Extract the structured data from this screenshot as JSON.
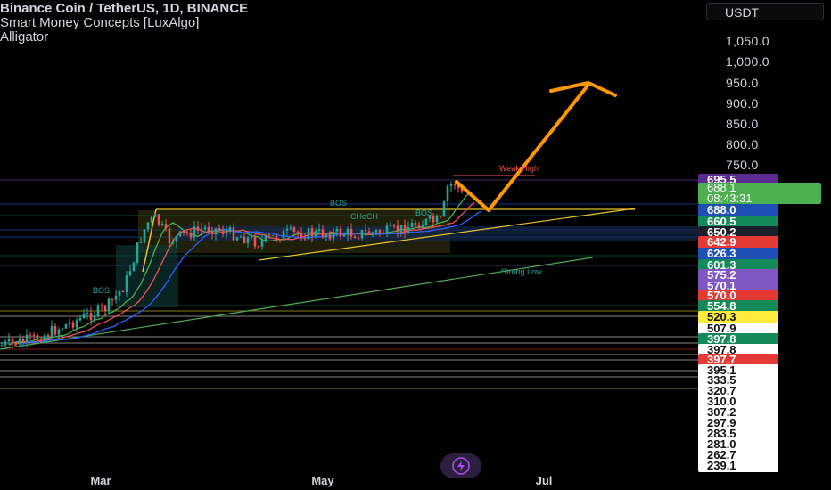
{
  "legend": {
    "symbol_line": "Binance Coin / TetherUS, 1D, BINANCE",
    "indicator_1": "Smart Money Concepts [LuxAlgo]",
    "indicator_2": "Alligator"
  },
  "currency": "USDT",
  "x_axis_labels": [
    "Mar",
    "May",
    "Jul"
  ],
  "y_axis_ticks": [
    "1,050.0",
    "1,000.0",
    "950.0",
    "900.0",
    "850.0",
    "800.0",
    "750.0"
  ],
  "price_labels": [
    {
      "text": "695.5",
      "color": "#5b2a91"
    },
    {
      "text": "688.0",
      "color": "#1e4fb5"
    },
    {
      "text": "660.5",
      "color": "#138a57"
    },
    {
      "text": "650.2",
      "color": "#1b1f2b"
    },
    {
      "text": "642.9",
      "color": "#e53935"
    },
    {
      "text": "626.3",
      "color": "#1e4fb5"
    },
    {
      "text": "601.3",
      "color": "#138a57"
    },
    {
      "text": "575.2",
      "color": "#7e57c2"
    },
    {
      "text": "570.1",
      "color": "#7e57c2"
    },
    {
      "text": "570.0",
      "color": "#e53935"
    },
    {
      "text": "554.8",
      "color": "#138a57"
    },
    {
      "text": "520.3",
      "color": "#ffeb3b"
    },
    {
      "text": "507.9",
      "color": "#ffffff"
    },
    {
      "text": "397.8",
      "color": "#138a57"
    },
    {
      "text": "397.8",
      "color": "#ffffff"
    },
    {
      "text": "397.7",
      "color": "#e53935"
    },
    {
      "text": "395.1",
      "color": "#ffffff"
    },
    {
      "text": "333.5",
      "color": "#ffffff"
    },
    {
      "text": "320.7",
      "color": "#ffffff"
    },
    {
      "text": "310.0",
      "color": "#ffffff"
    },
    {
      "text": "307.2",
      "color": "#ffffff"
    },
    {
      "text": "297.9",
      "color": "#ffffff"
    },
    {
      "text": "283.5",
      "color": "#ffffff"
    },
    {
      "text": "281.0",
      "color": "#ffffff"
    },
    {
      "text": "262.7",
      "color": "#ffffff"
    },
    {
      "text": "239.1",
      "color": "#ffffff"
    }
  ],
  "current_price": {
    "price": "688.1",
    "countdown": "08:43:31",
    "color": "#4caf50"
  },
  "annotations": {
    "weak_high": "Weak High",
    "strong_low": "Strong Low",
    "bos_top": "BOS",
    "bos_left": "BOS",
    "bos_mid": "BOS",
    "choch": "CHoCH"
  },
  "colors": {
    "bull": "#26a69a",
    "bear": "#ef5350",
    "arrow": "#ff9800",
    "trendline": "#e6c229",
    "green_line": "#4caf50",
    "blue_ma": "#2962ff"
  },
  "chart_data": {
    "type": "candlestick",
    "symbol": "Binance Coin / TetherUS",
    "interval": "1D",
    "exchange": "BINANCE",
    "x": [
      "Mar",
      "May",
      "Jul"
    ],
    "ylim": [
      230,
      1115
    ],
    "key_levels": [
      695.5,
      688.0,
      660.5,
      650.2,
      642.9,
      626.3,
      601.3,
      575.2,
      570.1,
      570.0,
      554.8,
      520.3,
      507.9,
      397.8,
      397.7,
      395.1,
      333.5,
      320.7,
      310.0,
      307.2,
      297.9,
      283.5,
      281.0,
      262.7,
      239.1
    ],
    "last_price": 688.1,
    "projection": [
      [
        688.0,
        712.0
      ],
      [
        660.5,
        945.0
      ]
    ],
    "grid": false,
    "legend": "top-left"
  }
}
